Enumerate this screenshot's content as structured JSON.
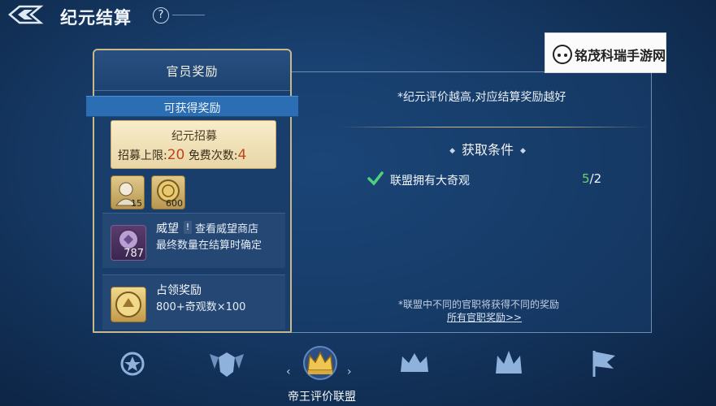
{
  "header": {
    "title": "纪元结算",
    "help_glyph": "?"
  },
  "watermark": {
    "text": "铭茂科瑞手游网"
  },
  "left_panel": {
    "title": "官员奖励",
    "banner": "可获得奖励",
    "recruit": {
      "title": "纪元招募",
      "limit_label": "招募上限:",
      "limit_value": "20",
      "free_label": "免费次数:",
      "free_value": "4"
    },
    "items": [
      {
        "icon": "portrait-token-icon",
        "count": "15"
      },
      {
        "icon": "gold-coin-icon",
        "count": "600"
      }
    ],
    "prestige": {
      "icon_count": "787",
      "name": "威望",
      "info_glyph": "!",
      "link": "查看威望商店",
      "desc": "最终数量在结算时确定"
    },
    "occupation": {
      "name": "占领奖励",
      "desc": "800+奇观数×100"
    }
  },
  "right_panel": {
    "hint_top": "*纪元评价越高,对应结算奖励越好",
    "conditions_title": "获取条件",
    "condition": {
      "label": "联盟拥有大奇观",
      "current": "5",
      "target": "/2"
    },
    "hint_bottom": "*联盟中不同的官职将获得不同的奖励",
    "link": "所有官职奖励>>"
  },
  "tabs": {
    "selected_label": "帝王评价联盟",
    "left_arrow": "‹",
    "right_arrow": "›"
  },
  "colors": {
    "background": "#163a66",
    "gold": "#c9b88a",
    "banner": "#2c6eb4",
    "progress_current": "#6ed16a"
  }
}
